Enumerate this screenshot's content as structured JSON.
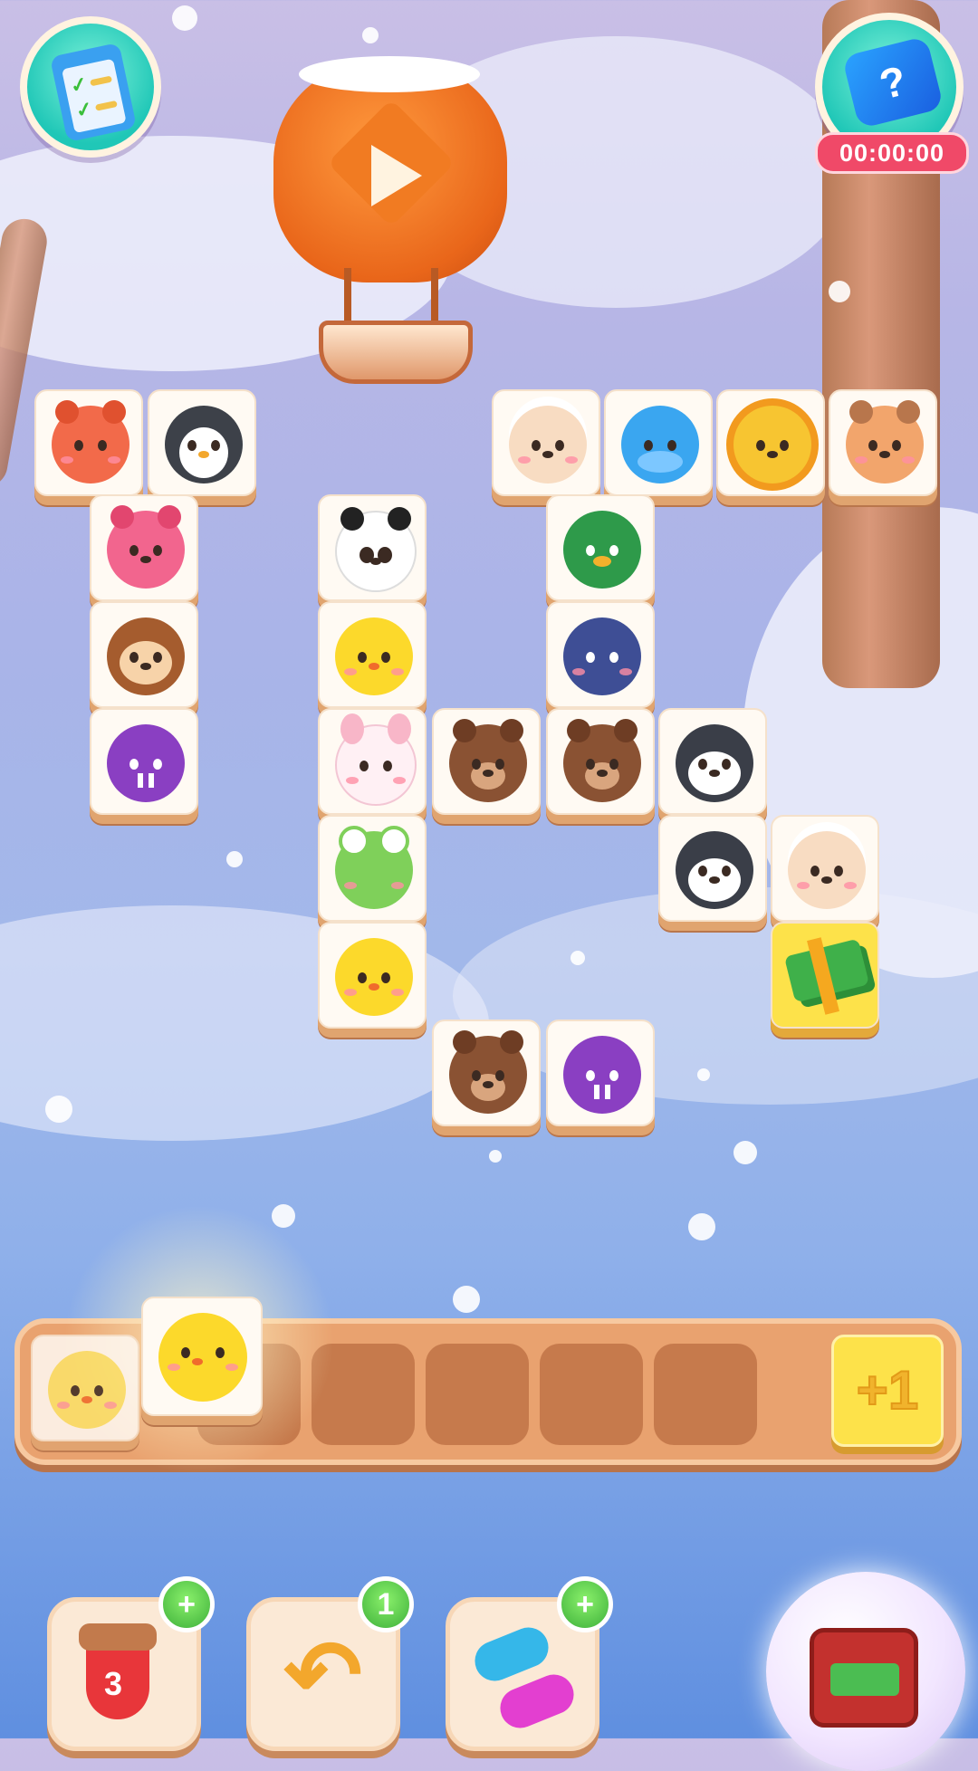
{
  "hud": {
    "tasks_icon": "clipboard-check-icon",
    "help_icon": "question-cube-icon",
    "help_symbol": "?",
    "timer": "00:00:00",
    "balloon_icon": "play-icon"
  },
  "board": {
    "tiles": [
      {
        "animal": "fox"
      },
      {
        "animal": "penguin"
      },
      {
        "animal": "sheep"
      },
      {
        "animal": "hippo"
      },
      {
        "animal": "lion"
      },
      {
        "animal": "deer"
      },
      {
        "animal": "pink-bear"
      },
      {
        "animal": "panda"
      },
      {
        "animal": "duck"
      },
      {
        "animal": "monkey"
      },
      {
        "animal": "chick"
      },
      {
        "animal": "elephant"
      },
      {
        "animal": "walrus"
      },
      {
        "animal": "bunny"
      },
      {
        "animal": "brown-bear"
      },
      {
        "animal": "brown-bear"
      },
      {
        "animal": "husky"
      },
      {
        "animal": "frog"
      },
      {
        "animal": "husky"
      },
      {
        "animal": "sheep"
      },
      {
        "animal": "chick"
      },
      {
        "animal": "cash"
      },
      {
        "animal": "brown-bear"
      },
      {
        "animal": "walrus"
      }
    ]
  },
  "tray": {
    "tiles": [
      {
        "animal": "chick"
      },
      {
        "animal": "chick"
      }
    ],
    "slots_total": 7,
    "extra_slot_label": "+1"
  },
  "boosters": {
    "sock": {
      "icon": "christmas-sock-icon",
      "count": "3",
      "badge": "+"
    },
    "undo": {
      "icon": "undo-arrow-icon",
      "badge": "1"
    },
    "shuffle": {
      "icon": "shuffle-icon",
      "badge": "+"
    },
    "chest": {
      "icon": "treasure-chest-icon"
    }
  }
}
